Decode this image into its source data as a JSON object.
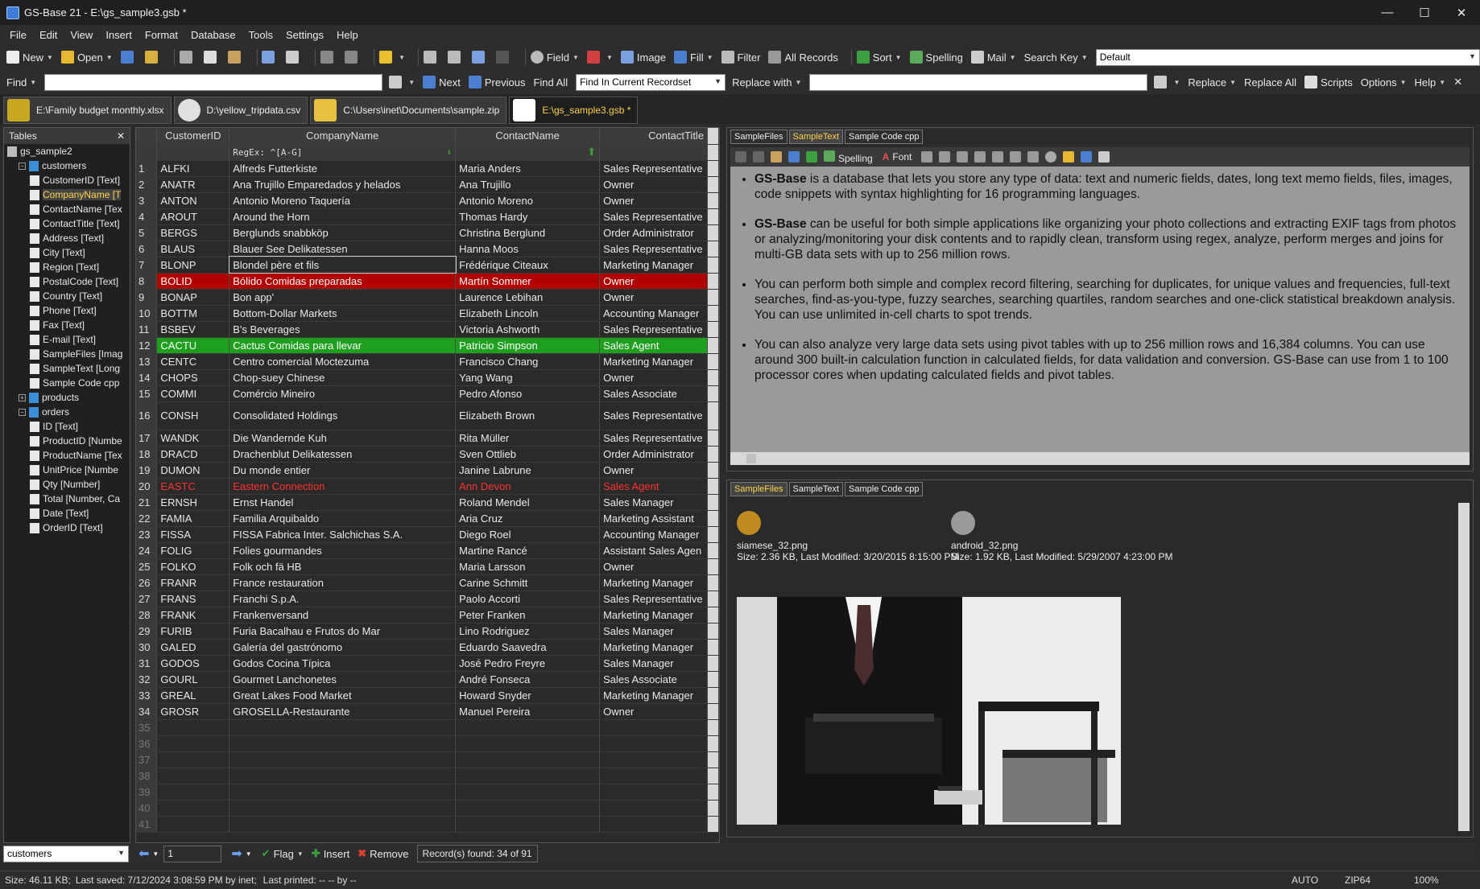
{
  "window": {
    "title": "GS-Base 21 - E:\\gs_sample3.gsb *",
    "min": "—",
    "max": "☐",
    "close": "✕"
  },
  "menu": [
    "File",
    "Edit",
    "View",
    "Insert",
    "Format",
    "Database",
    "Tools",
    "Settings",
    "Help"
  ],
  "toolbar1": {
    "new": "New",
    "open": "Open",
    "field": "Field",
    "image": "Image",
    "fill": "Fill",
    "filter": "Filter",
    "all_records": "All Records",
    "sort": "Sort",
    "spelling": "Spelling",
    "mail": "Mail",
    "search_key": "Search Key",
    "search_key_value": "Default"
  },
  "toolbar2": {
    "find": "Find",
    "find_value": "",
    "next": "Next",
    "previous": "Previous",
    "find_all": "Find All",
    "find_scope": "Find In Current Recordset",
    "replace_with": "Replace with",
    "replace_value": "",
    "replace": "Replace",
    "replace_all": "Replace All",
    "scripts": "Scripts",
    "options": "Options",
    "help": "Help"
  },
  "doc_tabs": [
    {
      "label": "E:\\Family budget monthly.xlsx",
      "color": "#c8a820"
    },
    {
      "label": "D:\\yellow_tripdata.csv",
      "color": "#e0e0e0"
    },
    {
      "label": "C:\\Users\\inet\\Documents\\sample.zip",
      "color": "#e8c040"
    },
    {
      "label": "E:\\gs_sample3.gsb *",
      "color": "#ffffff"
    }
  ],
  "tree": {
    "title": "Tables",
    "items": [
      {
        "label": "gs_sample2",
        "level": 0
      },
      {
        "label": "customers",
        "level": 1
      },
      {
        "label": "CustomerID  [Text]",
        "level": 2
      },
      {
        "label": "CompanyName  [T",
        "level": 2,
        "selected": true
      },
      {
        "label": "ContactName  [Tex",
        "level": 2
      },
      {
        "label": "ContactTitle  [Text]",
        "level": 2
      },
      {
        "label": "Address  [Text]",
        "level": 2
      },
      {
        "label": "City  [Text]",
        "level": 2
      },
      {
        "label": "Region  [Text]",
        "level": 2
      },
      {
        "label": "PostalCode  [Text]",
        "level": 2
      },
      {
        "label": "Country  [Text]",
        "level": 2
      },
      {
        "label": "Phone  [Text]",
        "level": 2
      },
      {
        "label": "Fax  [Text]",
        "level": 2
      },
      {
        "label": "E-mail  [Text]",
        "level": 2
      },
      {
        "label": "SampleFiles  [Imag",
        "level": 2
      },
      {
        "label": "SampleText  [Long",
        "level": 2
      },
      {
        "label": "Sample Code cpp",
        "level": 2
      },
      {
        "label": "products",
        "level": 1
      },
      {
        "label": "orders",
        "level": 1
      },
      {
        "label": "ID  [Text]",
        "level": 2
      },
      {
        "label": "ProductID  [Numbe",
        "level": 2
      },
      {
        "label": "ProductName  [Tex",
        "level": 2
      },
      {
        "label": "UnitPrice  [Numbe",
        "level": 2
      },
      {
        "label": "Qty  [Number]",
        "level": 2
      },
      {
        "label": "Total  [Number, Ca",
        "level": 2
      },
      {
        "label": "Date  [Text]",
        "level": 2
      },
      {
        "label": "OrderID  [Text]",
        "level": 2
      }
    ]
  },
  "grid": {
    "columns": [
      "CustomerID",
      "CompanyName",
      "ContactName",
      "ContactTitle"
    ],
    "filter_regex": "RegEx: ^[A-G]",
    "rows": [
      [
        "1",
        "ALFKI",
        "Alfreds Futterkiste",
        "Maria Anders",
        "Sales Representative",
        ""
      ],
      [
        "2",
        "ANATR",
        "Ana Trujillo Emparedados y helados",
        "Ana Trujillo",
        "Owner",
        ""
      ],
      [
        "3",
        "ANTON",
        "Antonio Moreno Taquería",
        "Antonio Moreno",
        "Owner",
        ""
      ],
      [
        "4",
        "AROUT",
        "Around the Horn",
        "Thomas Hardy",
        "Sales Representative",
        ""
      ],
      [
        "5",
        "BERGS",
        "Berglunds snabbköp",
        "Christina Berglund",
        "Order Administrator",
        ""
      ],
      [
        "6",
        "BLAUS",
        "Blauer See Delikatessen",
        "Hanna Moos",
        "Sales Representative",
        ""
      ],
      [
        "7",
        "BLONP",
        "Blondel père et fils",
        "Frédérique Citeaux",
        "Marketing Manager",
        "cur"
      ],
      [
        "8",
        "BOLID",
        "Bólido Comidas preparadas",
        "Martín Sommer",
        "Owner",
        "red"
      ],
      [
        "9",
        "BONAP",
        "Bon app'",
        "Laurence Lebihan",
        "Owner",
        ""
      ],
      [
        "10",
        "BOTTM",
        "Bottom-Dollar Markets",
        "Elizabeth Lincoln",
        "Accounting Manager",
        ""
      ],
      [
        "11",
        "BSBEV",
        "B's Beverages",
        "Victoria Ashworth",
        "Sales Representative",
        ""
      ],
      [
        "12",
        "CACTU",
        "Cactus Comidas para llevar",
        "Patricio Simpson",
        "Sales Agent",
        "green"
      ],
      [
        "13",
        "CENTC",
        "Centro comercial Moctezuma",
        "Francisco Chang",
        "Marketing Manager",
        ""
      ],
      [
        "14",
        "CHOPS",
        "Chop-suey Chinese",
        "Yang Wang",
        "Owner",
        ""
      ],
      [
        "15",
        "COMMI",
        "Comércio Mineiro",
        "Pedro Afonso",
        "Sales Associate",
        ""
      ],
      [
        "16",
        "CONSH",
        "Consolidated Holdings",
        "Elizabeth Brown",
        "Sales Representative",
        "tall"
      ],
      [
        "17",
        "WANDK",
        "Die Wandernde Kuh",
        "Rita Müller",
        "Sales Representative",
        ""
      ],
      [
        "18",
        "DRACD",
        "Drachenblut Delikatessen",
        "Sven Ottlieb",
        "Order Administrator",
        ""
      ],
      [
        "19",
        "DUMON",
        "Du monde entier",
        "Janine Labrune",
        "Owner",
        ""
      ],
      [
        "20",
        "EASTC",
        "Eastern Connection",
        "Ann Devon",
        "Sales Agent",
        "redtext"
      ],
      [
        "21",
        "ERNSH",
        "Ernst Handel",
        "Roland Mendel",
        "Sales Manager",
        ""
      ],
      [
        "22",
        "FAMIA",
        "Familia Arquibaldo",
        "Aria Cruz",
        "Marketing Assistant",
        ""
      ],
      [
        "23",
        "FISSA",
        "FISSA Fabrica Inter. Salchichas S.A.",
        "Diego Roel",
        "Accounting Manager",
        ""
      ],
      [
        "24",
        "FOLIG",
        "Folies gourmandes",
        "Martine Rancé",
        "Assistant Sales Agen",
        ""
      ],
      [
        "25",
        "FOLKO",
        "Folk och fä HB",
        "Maria Larsson",
        "Owner",
        ""
      ],
      [
        "26",
        "FRANR",
        "France restauration",
        "Carine Schmitt",
        "Marketing Manager",
        ""
      ],
      [
        "27",
        "FRANS",
        "Franchi S.p.A.",
        "Paolo Accorti",
        "Sales Representative",
        ""
      ],
      [
        "28",
        "FRANK",
        "Frankenversand",
        "Peter Franken",
        "Marketing Manager",
        ""
      ],
      [
        "29",
        "FURIB",
        "Furia Bacalhau e Frutos do Mar",
        "Lino Rodriguez",
        "Sales Manager",
        ""
      ],
      [
        "30",
        "GALED",
        "Galería del gastrónomo",
        "Eduardo Saavedra",
        "Marketing Manager",
        ""
      ],
      [
        "31",
        "GODOS",
        "Godos Cocina Típica",
        "José Pedro Freyre",
        "Sales Manager",
        ""
      ],
      [
        "32",
        "GOURL",
        "Gourmet Lanchonetes",
        "André Fonseca",
        "Sales Associate",
        ""
      ],
      [
        "33",
        "GREAL",
        "Great Lakes Food Market",
        "Howard Snyder",
        "Marketing Manager",
        ""
      ],
      [
        "34",
        "GROSR",
        "GROSELLA-Restaurante",
        "Manuel Pereira",
        "Owner",
        ""
      ]
    ],
    "empty_rows": [
      "35",
      "36",
      "37",
      "38",
      "39",
      "40",
      "41"
    ]
  },
  "right_top": {
    "tabs": [
      "SampleFiles",
      "SampleText",
      "Sample Code cpp"
    ],
    "active_tab": 1,
    "fmt_spelling": "Spelling",
    "fmt_font": "Font",
    "paragraphs": [
      {
        "bold": "GS-Base",
        "text": " is a database that lets you store any type of data: text and numeric fields, dates, long text memo fields, files, images, code snippets with syntax highlighting for 16 programming languages."
      },
      {
        "bold": "GS-Base",
        "text": " can be useful for both simple applications like organizing your photo collections and extracting EXIF tags from photos or analyzing/monitoring your disk contents and to rapidly clean, transform using regex, analyze, perform merges and joins for multi-GB data sets with up to 256 million rows."
      },
      {
        "bold": "",
        "text": "You can perform both simple and complex record filtering, searching for duplicates, for unique values and frequencies, full-text searches, find-as-you-type, fuzzy searches, searching quartiles, random searches and one-click statistical breakdown analysis. You can use unlimited in-cell charts to spot trends."
      },
      {
        "bold": "",
        "text": "You can also analyze very large data sets using pivot tables with up to 256 million rows and 16,384 columns. You can use around 300 built-in calculation function in calculated fields, for data validation and conversion. GS-Base can use from 1 to 100 processor cores when updating calculated fields and pivot tables."
      }
    ]
  },
  "right_bottom": {
    "tabs": [
      "SampleFiles",
      "SampleText",
      "Sample Code cpp"
    ],
    "active_tab": 0,
    "files": [
      {
        "name": "siamese_32.png",
        "info": "Size: 2.36 KB, Last Modified: 3/20/2015 8:15:00 PM"
      },
      {
        "name": "android_32.png",
        "info": "Size: 1.92 KB, Last Modified: 5/29/2007 4:23:00 PM"
      }
    ]
  },
  "navbar": {
    "table": "customers",
    "record": "1",
    "flag": "Flag",
    "insert": "Insert",
    "remove": "Remove",
    "found": "Record(s) found: 34 of 91"
  },
  "status": {
    "size": "Size: 46.11 KB;",
    "saved": "Last saved: 7/12/2024 3:08:59 PM by inet;",
    "printed": "Last printed: -- -- by --",
    "auto": "AUTO",
    "zip": "ZIP64",
    "zoom": "100%"
  }
}
